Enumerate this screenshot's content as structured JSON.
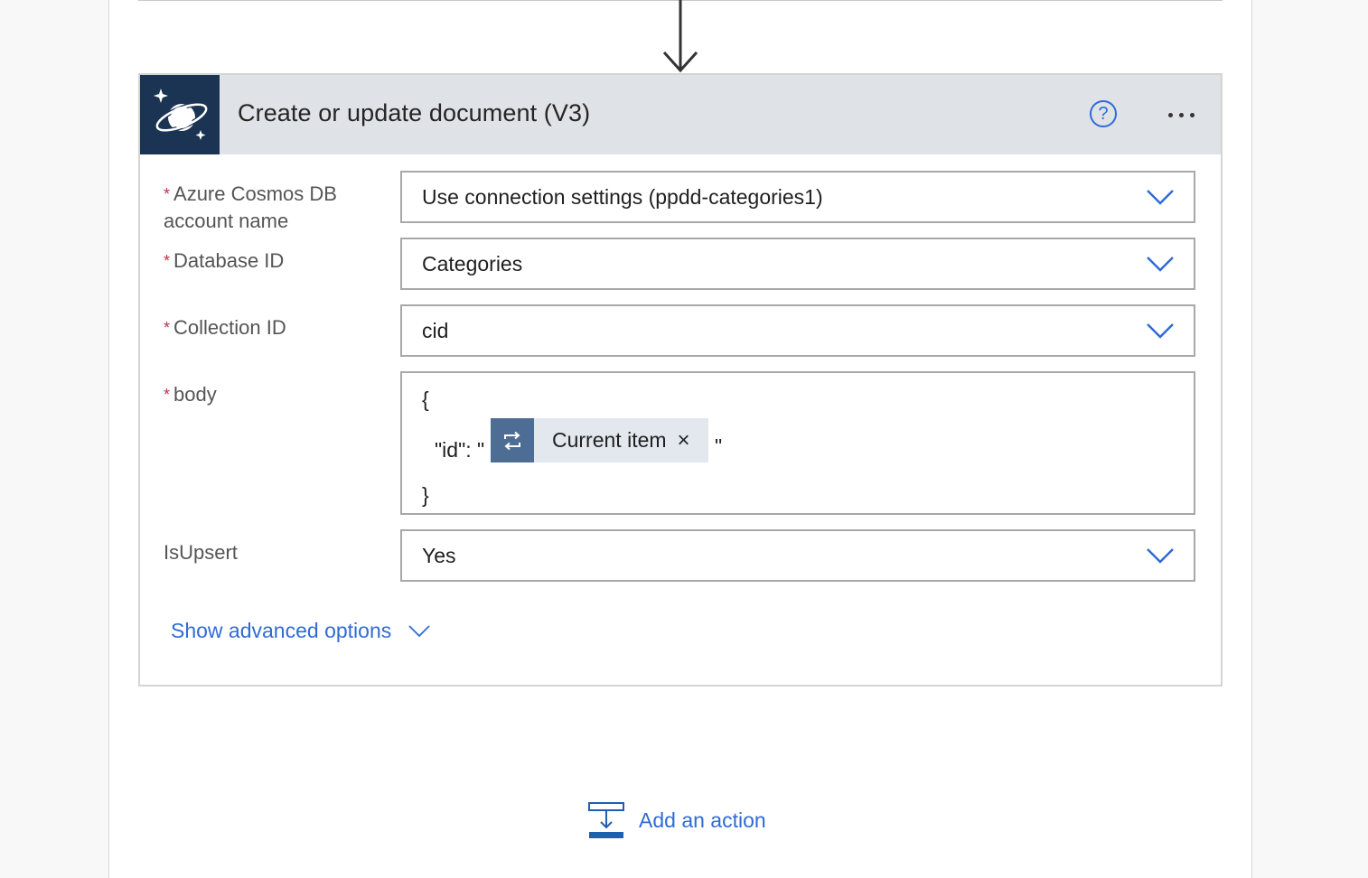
{
  "card": {
    "title": "Create or update document (V3)",
    "icon": "cosmos-db-planet-icon",
    "help_label": "?",
    "more_icon": "more-ellipsis-icon"
  },
  "fields": {
    "account": {
      "required_mark": "*",
      "label_line1": "Azure Cosmos DB",
      "label_line2": "account name",
      "value": "Use connection settings (ppdd-categories1)"
    },
    "database": {
      "required_mark": "*",
      "label": "Database ID",
      "value": "Categories"
    },
    "collection": {
      "required_mark": "*",
      "label": "Collection ID",
      "value": "cid"
    },
    "body": {
      "required_mark": "*",
      "label": "body",
      "open_brace": "{",
      "id_prefix": "\"id\": \"",
      "token_label": "Current item",
      "token_remove": "×",
      "id_suffix": "\"",
      "close_brace": "}"
    },
    "isupsert": {
      "label": "IsUpsert",
      "value": "Yes"
    }
  },
  "advanced_label": "Show advanced options",
  "add_action_label": "Add an action",
  "colors": {
    "accent": "#2f6bd6",
    "header_bg": "#dfe2e6",
    "connector_bg": "#1b3454",
    "token_icon_bg": "#4d6d94",
    "required": "#c4314b"
  }
}
